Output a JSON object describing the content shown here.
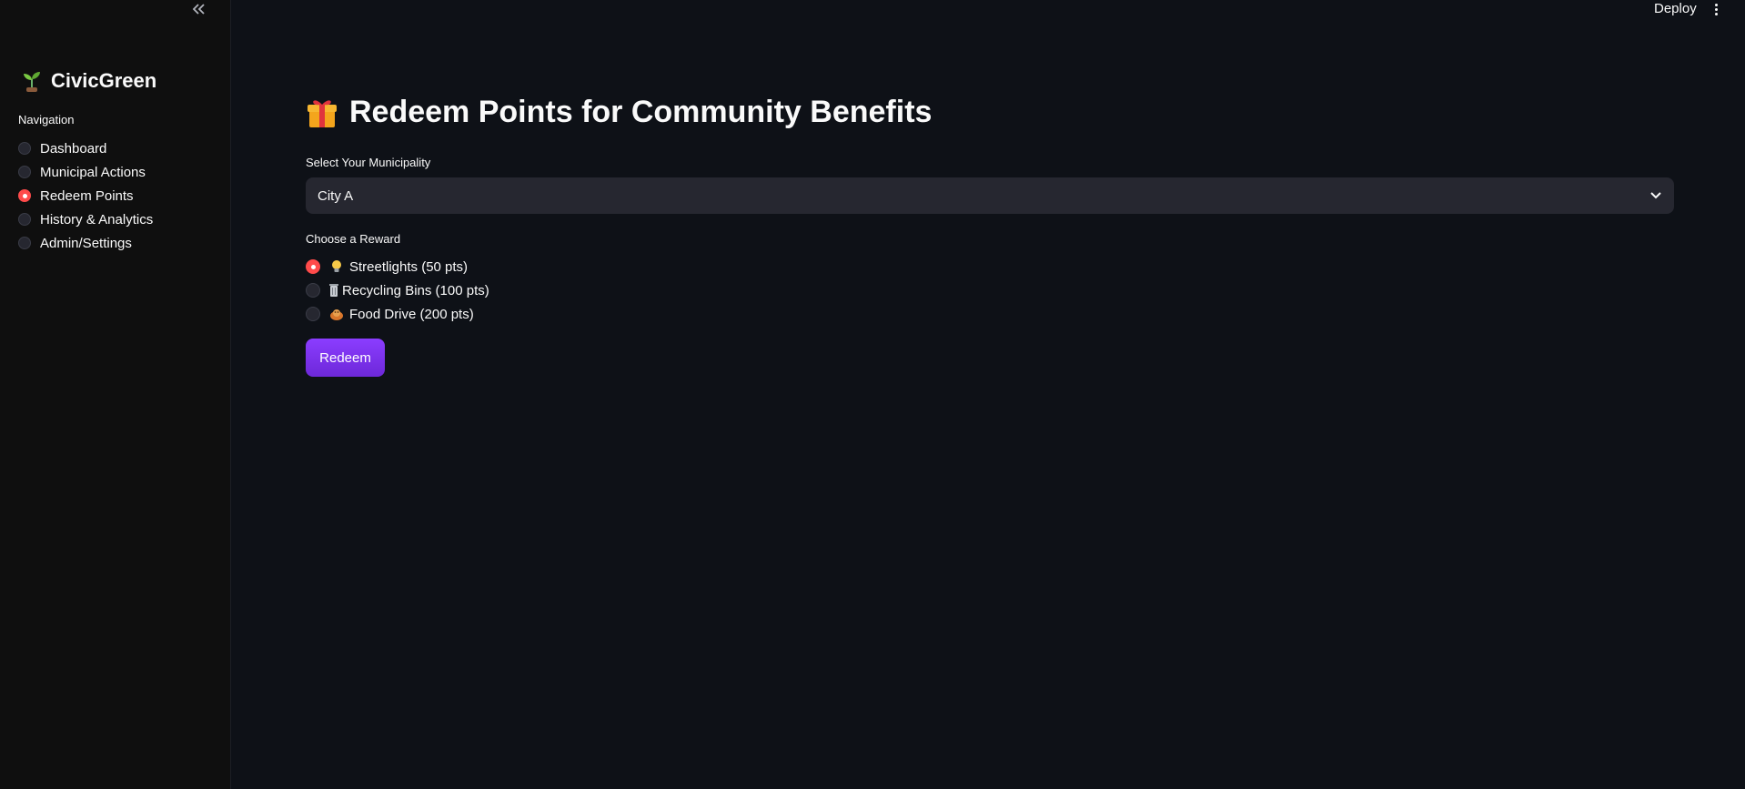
{
  "header": {
    "deploy_label": "Deploy"
  },
  "sidebar": {
    "brand": "CivicGreen",
    "nav_label": "Navigation",
    "items": [
      {
        "label": "Dashboard",
        "selected": false
      },
      {
        "label": "Municipal Actions",
        "selected": false
      },
      {
        "label": "Redeem Points",
        "selected": true
      },
      {
        "label": "History & Analytics",
        "selected": false
      },
      {
        "label": "Admin/Settings",
        "selected": false
      }
    ]
  },
  "main": {
    "title": "Redeem Points for Community Benefits",
    "municipality_label": "Select Your Municipality",
    "municipality_value": "City A",
    "reward_label": "Choose a Reward",
    "rewards": [
      {
        "label": "Streetlights (50 pts)",
        "icon": "lightbulb-icon",
        "selected": true
      },
      {
        "label": "Recycling Bins (100 pts)",
        "icon": "wastebasket-icon",
        "selected": false
      },
      {
        "label": "Food Drive (200 pts)",
        "icon": "food-icon",
        "selected": false
      }
    ],
    "redeem_label": "Redeem"
  },
  "colors": {
    "background": "#0e1117",
    "sidebar": "#0f0f0f",
    "radio_selected": "#ff4b4b",
    "button": "#7c3aed"
  }
}
